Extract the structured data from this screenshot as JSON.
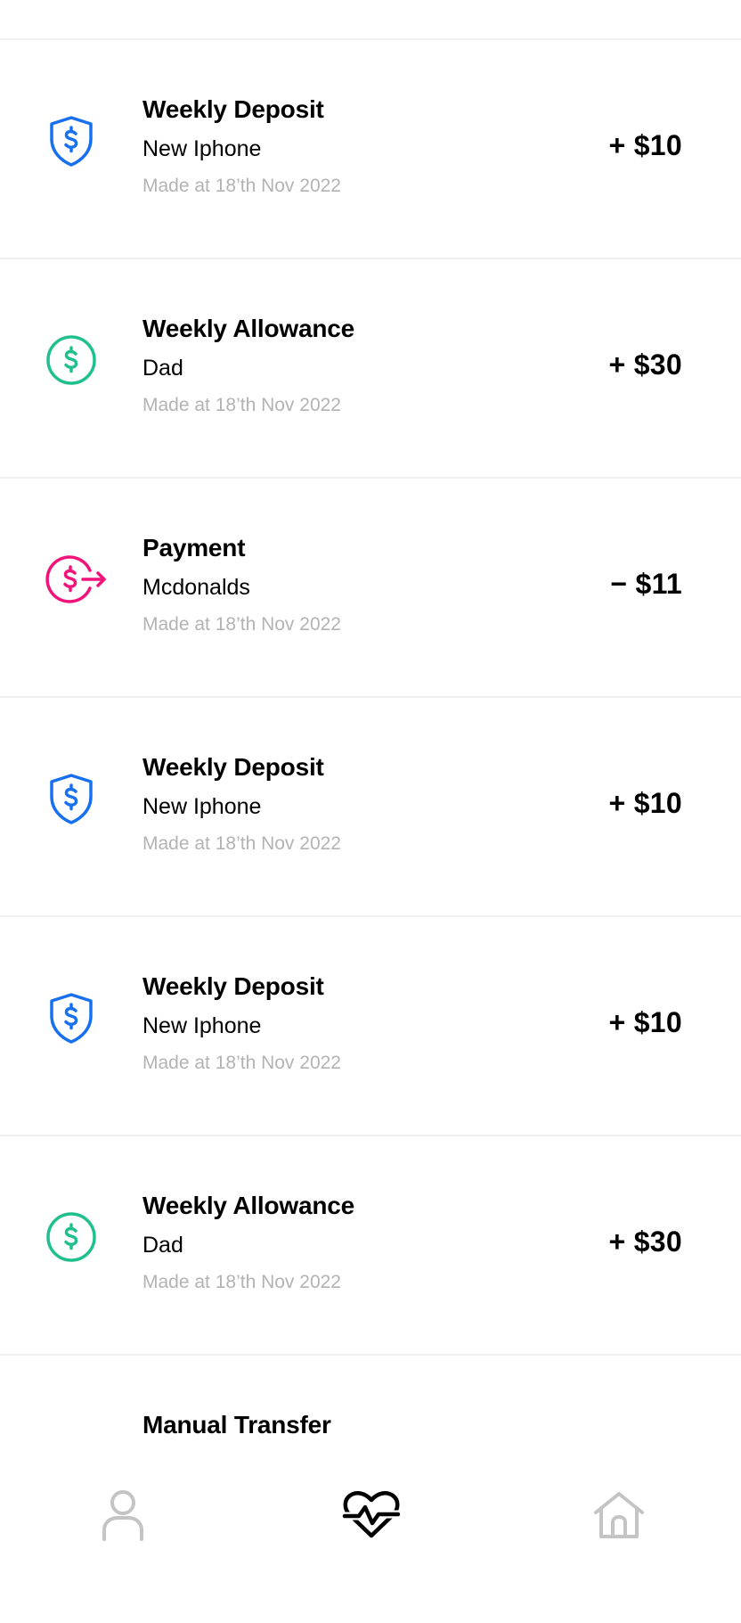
{
  "transactions": [
    {
      "title": "Weekly Deposit",
      "subtitle": "New Iphone",
      "date": "Made at 18’th Nov 2022",
      "amount": "+ $10",
      "icon": "shield-dollar-icon",
      "icon_color": "#1670f0"
    },
    {
      "title": "Weekly Allowance",
      "subtitle": "Dad",
      "date": "Made at 18’th Nov 2022",
      "amount": "+ $30",
      "icon": "dollar-circle-icon",
      "icon_color": "#1fbf8f"
    },
    {
      "title": "Payment",
      "subtitle": "Mcdonalds",
      "date": "Made at 18’th Nov 2022",
      "amount": "− $11",
      "icon": "dollar-send-icon",
      "icon_color": "#f0147a"
    },
    {
      "title": "Weekly Deposit",
      "subtitle": "New Iphone",
      "date": "Made at 18’th Nov 2022",
      "amount": "+ $10",
      "icon": "shield-dollar-icon",
      "icon_color": "#1670f0"
    },
    {
      "title": "Weekly Deposit",
      "subtitle": "New Iphone",
      "date": "Made at 18’th Nov 2022",
      "amount": "+ $10",
      "icon": "shield-dollar-icon",
      "icon_color": "#1670f0"
    },
    {
      "title": "Weekly Allowance",
      "subtitle": "Dad",
      "date": "Made at 18’th Nov 2022",
      "amount": "+ $30",
      "icon": "dollar-circle-icon",
      "icon_color": "#1fbf8f"
    },
    {
      "title": "Manual Transfer"
    }
  ],
  "bottom_nav": {
    "items": [
      {
        "icon": "person-icon",
        "active": false,
        "color": "#c4c4c4"
      },
      {
        "icon": "heart-pulse-icon",
        "active": true,
        "color": "#000000"
      },
      {
        "icon": "home-icon",
        "active": false,
        "color": "#c4c4c4"
      }
    ]
  }
}
